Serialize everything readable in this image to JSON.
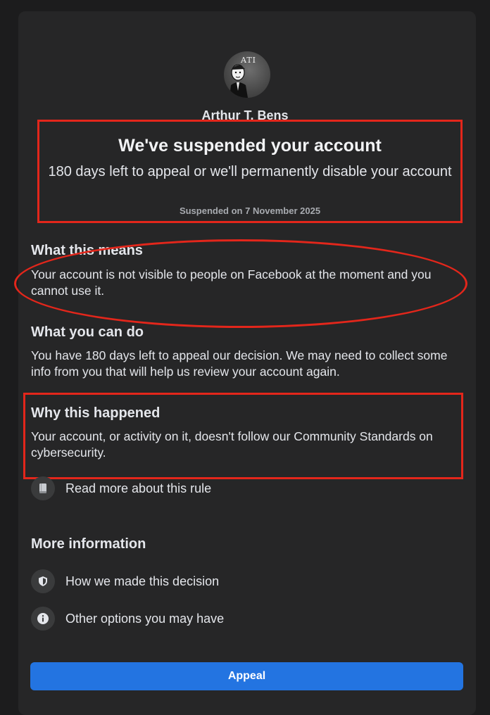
{
  "profile": {
    "name": "Arthur T. Bens",
    "avatar_initials": "ATI"
  },
  "suspension": {
    "headline": "We've suspended your account",
    "subtitle": "180 days left to appeal or we'll permanently disable your account",
    "date": "Suspended on 7 November 2025"
  },
  "sections": {
    "meaning": {
      "heading": "What this means",
      "body": "Your account is not visible to people on Facebook at the moment and you cannot use it."
    },
    "options": {
      "heading": "What you can do",
      "body": "You have 180 days left to appeal our decision. We may need to collect some info from you that will help us review your account again."
    },
    "reason": {
      "heading": "Why this happened",
      "body": "Your account, or activity on it, doesn't follow our Community Standards on cybersecurity."
    }
  },
  "rule_link": {
    "label": "Read more about this rule",
    "icon": "book-icon"
  },
  "more_info": {
    "heading": "More information",
    "items": [
      {
        "label": "How we made this decision",
        "icon": "shield-icon"
      },
      {
        "label": "Other options you may have",
        "icon": "info-icon"
      }
    ]
  },
  "actions": {
    "appeal_label": "Appeal"
  },
  "colors": {
    "background": "#1c1c1d",
    "card": "#262627",
    "annotation": "#e3261b",
    "primary_button": "#2374e1"
  }
}
